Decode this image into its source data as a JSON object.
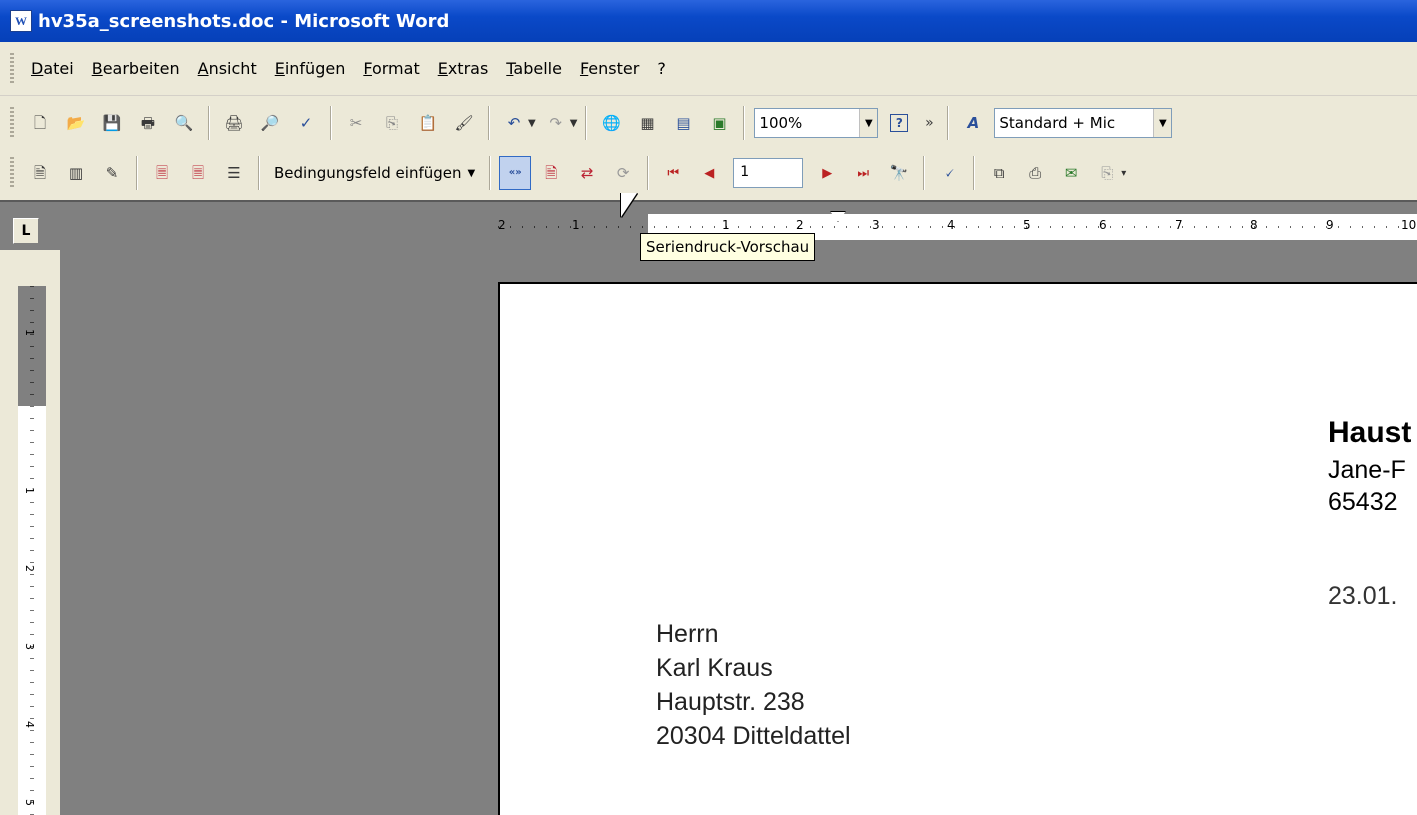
{
  "window": {
    "title": "hv35a_screenshots.doc - Microsoft Word",
    "app_icon_letter": "W"
  },
  "menu": [
    "Datei",
    "Bearbeiten",
    "Ansicht",
    "Einfügen",
    "Format",
    "Extras",
    "Tabelle",
    "Fenster",
    "?"
  ],
  "toolbar_standard": {
    "zoom": "100%",
    "style": "Standard + Mic"
  },
  "toolbar_mailmerge": {
    "insert_field_label": "Bedingungsfeld einfügen",
    "record_number": "1"
  },
  "ruler": {
    "numbers": [
      "2",
      "1",
      "1",
      "2",
      "3",
      "4",
      "5",
      "6",
      "7",
      "8",
      "9",
      "10"
    ],
    "vertical_numbers": [
      "1",
      "1",
      "2",
      "3",
      "4",
      "5"
    ]
  },
  "tooltip": "Seriendruck-Vorschau",
  "document": {
    "sender_name": "Haust",
    "sender_street": "Jane-F",
    "sender_city": "65432",
    "date": "23.01.",
    "recipient": [
      "Herrn",
      "Karl Kraus",
      "Hauptstr. 238",
      "20304 Ditteldattel"
    ]
  }
}
